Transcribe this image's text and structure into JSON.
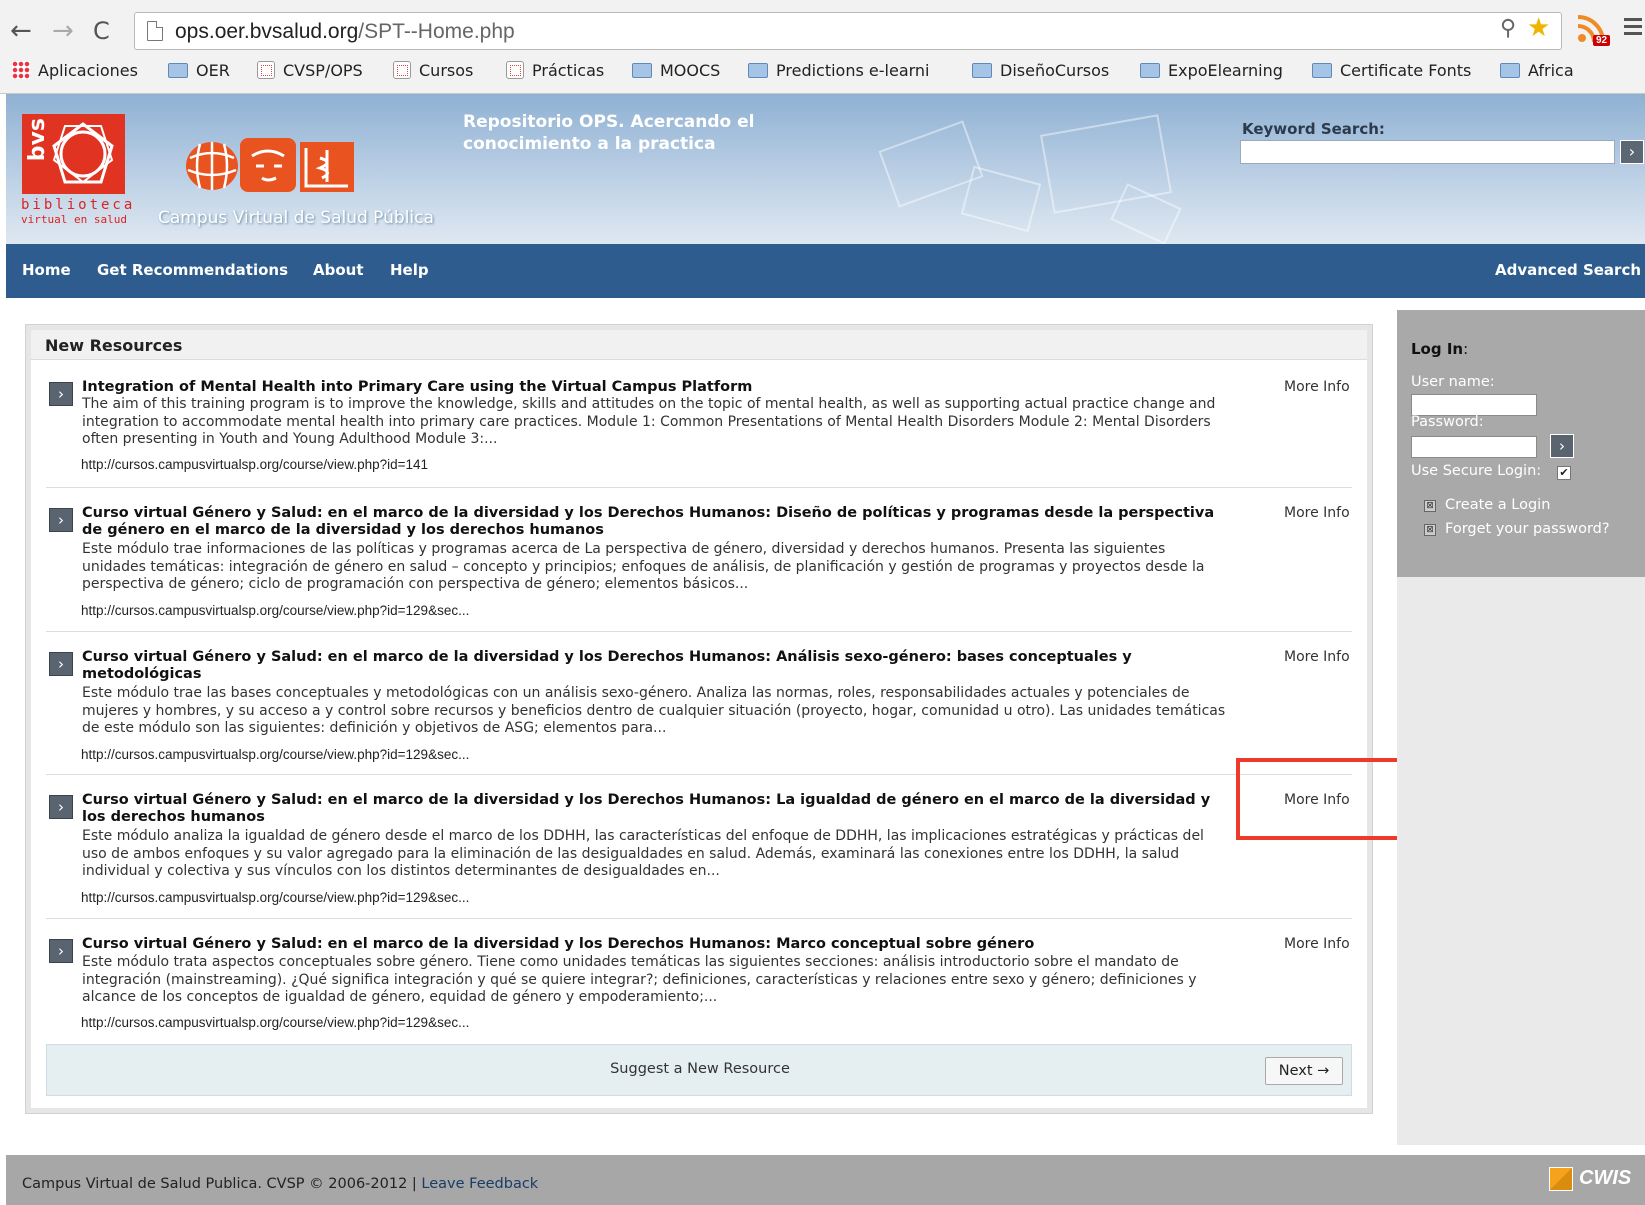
{
  "browser": {
    "url_host": "ops.oer.bvsalud.org",
    "url_path": "/SPT--Home.php",
    "rss_badge": "92",
    "bookmarks": [
      {
        "label": "Aplicaciones",
        "icon": "apps-grid-icon"
      },
      {
        "label": "OER",
        "icon": "folder-icon"
      },
      {
        "label": "CVSP/OPS",
        "icon": "calendar-icon"
      },
      {
        "label": "Cursos",
        "icon": "calendar-icon"
      },
      {
        "label": "Prácticas",
        "icon": "calendar-icon"
      },
      {
        "label": "MOOCS",
        "icon": "folder-icon"
      },
      {
        "label": "Predictions e-learni",
        "icon": "folder-icon"
      },
      {
        "label": "DiseñoCursos",
        "icon": "folder-icon"
      },
      {
        "label": "ExpoElearning",
        "icon": "folder-icon"
      },
      {
        "label": "Certificate Fonts",
        "icon": "folder-icon"
      },
      {
        "label": "Africa",
        "icon": "folder-icon"
      }
    ]
  },
  "header": {
    "bvs_vertical": "bvs",
    "bvs_line1": "biblioteca",
    "bvs_line2": "virtual en salud",
    "site_name": "Campus Virtual de Salud Pública",
    "tagline": "Repositorio OPS. Acercando el conocimiento a la practica",
    "keyword_label": "Keyword Search:"
  },
  "nav": {
    "home": "Home",
    "recommendations": "Get Recommendations",
    "about": "About",
    "help": "Help",
    "advanced": "Advanced Search"
  },
  "main": {
    "panel_title": "New Resources",
    "more_info_label": "More Info",
    "resources": [
      {
        "title": "Integration of Mental Health into Primary Care using the Virtual Campus Platform",
        "description": "The aim of this training program is to improve the knowledge, skills and attitudes on the topic of mental health, as well as supporting actual practice change and integration to accommodate mental health into primary care practices. Module 1: Common Presentations of Mental Health Disorders Module 2: Mental Disorders often presenting in Youth and Young Adulthood Module 3:...",
        "url": "http://cursos.campusvirtualsp.org/course/view.php?id=141"
      },
      {
        "title": "Curso virtual Género y Salud: en el marco de la diversidad y los Derechos Humanos: Diseño de políticas y programas desde la perspectiva de género en el marco de la diversidad y los derechos humanos",
        "description": "Este módulo trae informaciones de las políticas y programas acerca de La perspectiva de género, diversidad y derechos humanos. Presenta las siguientes unidades temáticas: integración de género en salud – concepto y principios; enfoques de análisis, de planificación y gestión de programas y proyectos desde la perspectiva de género; ciclo de programación con perspectiva de género; elementos básicos...",
        "url": "http://cursos.campusvirtualsp.org/course/view.php?id=129&sec..."
      },
      {
        "title": "Curso virtual Género y Salud: en el marco de la diversidad y los Derechos Humanos: Análisis sexo-género: bases conceptuales y metodológicas",
        "description": "Este módulo trae las bases conceptuales y metodológicas con un análisis sexo-género. Analiza las normas, roles, responsabilidades actuales y potenciales de mujeres y hombres, y su acceso a y control sobre recursos y beneficios dentro de cualquier situación (proyecto, hogar, comunidad u otro). Las unidades temáticas de este módulo son las siguientes: definición y objetivos de ASG; elementos para...",
        "url": "http://cursos.campusvirtualsp.org/course/view.php?id=129&sec..."
      },
      {
        "title": "Curso virtual Género y Salud: en el marco de la diversidad y los Derechos Humanos: La igualdad de género en el marco de la diversidad y los derechos humanos",
        "description": "Este módulo analiza la igualdad de género desde el marco de los DDHH, las características del enfoque de DDHH, las implicaciones estratégicas y prácticas del uso de ambos enfoques y su valor agregado para la eliminación de las desigualdades en salud. Además, examinará las conexiones entre los DDHH, la salud individual y colectiva y sus vínculos con los distintos determinantes de desigualdades en...",
        "url": "http://cursos.campusvirtualsp.org/course/view.php?id=129&sec..."
      },
      {
        "title": "Curso virtual Género y Salud: en el marco de la diversidad y los Derechos Humanos: Marco conceptual sobre género",
        "description": "Este módulo trata aspectos conceptuales sobre género. Tiene como unidades temáticas las siguientes secciones: análisis introductorio sobre el mandato de integración (mainstreaming). ¿Qué significa integración y qué se quiere integrar?; definiciones, características y relaciones entre sexo y género; definiciones y alcance de los conceptos de igualdad de género, equidad de género y empoderamiento;...",
        "url": "http://cursos.campusvirtualsp.org/course/view.php?id=129&sec..."
      }
    ],
    "suggest_label": "Suggest a New Resource",
    "next_label": "Next →"
  },
  "sidebar": {
    "login_title": "Log In",
    "login_colon": ":",
    "username_label": "User name:",
    "password_label": "Password:",
    "secure_label": "Use Secure Login:",
    "secure_checked": "✔",
    "create_login": "Create a Login",
    "forgot_password": "Forget your password?"
  },
  "footer": {
    "copyright": "Campus Virtual de Salud Publica. CVSP © 2006-2012 | ",
    "feedback": "Leave Feedback",
    "cwis": "CWIS"
  },
  "colors": {
    "nav_blue": "#2e5c8e",
    "highlight_red": "#ee3a2a",
    "bvs_red": "#e03322"
  }
}
